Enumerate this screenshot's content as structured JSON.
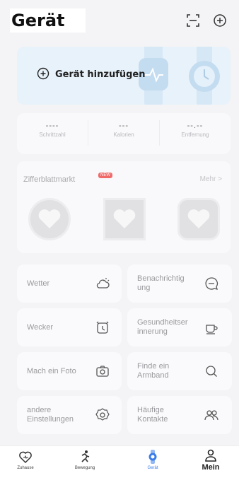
{
  "header": {
    "title": "Gerät",
    "icons": [
      "scan-icon",
      "add-circle-icon"
    ]
  },
  "banner": {
    "label": "Gerät hinzufügen",
    "icon": "add-circle-icon"
  },
  "stats": [
    {
      "value": "----",
      "label": "Schrittzahl"
    },
    {
      "value": "---",
      "label": "Kalorien"
    },
    {
      "value": "--.--",
      "label": "Entfernung"
    }
  ],
  "watch_faces": {
    "title": "Zifferblattmarkt",
    "badge": "NEW",
    "more": "Mehr >"
  },
  "tiles": [
    {
      "label": "Wetter",
      "icon": "weather-icon"
    },
    {
      "label": "Benachrichtig ung",
      "icon": "message-icon"
    },
    {
      "label": "Wecker",
      "icon": "alarm-icon"
    },
    {
      "label": "Gesundheitser innerung",
      "icon": "cup-icon"
    },
    {
      "label": "Mach ein Foto",
      "icon": "camera-icon"
    },
    {
      "label": "Finde ein Armband",
      "icon": "search-icon"
    },
    {
      "label": "andere Einstellungen",
      "icon": "settings-icon"
    },
    {
      "label": "Häufige Kontakte",
      "icon": "contacts-icon"
    }
  ],
  "nav": [
    {
      "label": "Zuhause",
      "icon": "heart-home-icon"
    },
    {
      "label": "Bewegung",
      "icon": "running-icon"
    },
    {
      "label": "Gerät",
      "icon": "watch-icon",
      "active": true
    },
    {
      "label": "Mein",
      "icon": "person-icon"
    }
  ],
  "colors": {
    "accent": "#3a7de8",
    "badge": "#f06a6a",
    "banner_bg": "#e8f2fa"
  }
}
